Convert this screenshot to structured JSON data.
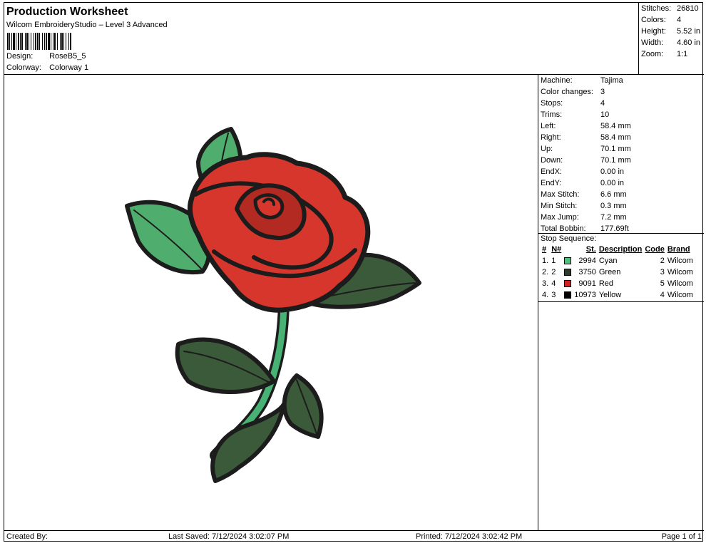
{
  "header": {
    "title": "Production Worksheet",
    "subtitle": "Wilcom EmbroideryStudio – Level 3 Advanced",
    "design_label": "Design:",
    "design_value": "RoseB5_5",
    "colorway_label": "Colorway:",
    "colorway_value": "Colorway 1"
  },
  "summary": [
    {
      "label": "Stitches:",
      "value": "26810"
    },
    {
      "label": "Colors:",
      "value": "4"
    },
    {
      "label": "Height:",
      "value": "5.52 in"
    },
    {
      "label": "Width:",
      "value": "4.60 in"
    },
    {
      "label": "Zoom:",
      "value": "1:1"
    }
  ],
  "details": [
    {
      "label": "Machine:",
      "value": "Tajima"
    },
    {
      "label": "Color changes:",
      "value": "3"
    },
    {
      "label": "Stops:",
      "value": "4"
    },
    {
      "label": "Trims:",
      "value": "10"
    },
    {
      "label": "Left:",
      "value": "58.4 mm"
    },
    {
      "label": "Right:",
      "value": "58.4 mm"
    },
    {
      "label": "Up:",
      "value": "70.1 mm"
    },
    {
      "label": "Down:",
      "value": "70.1 mm"
    },
    {
      "label": "EndX:",
      "value": "0.00 in"
    },
    {
      "label": "EndY:",
      "value": "0.00 in"
    },
    {
      "label": "Max Stitch:",
      "value": "6.6 mm"
    },
    {
      "label": "Min Stitch:",
      "value": "0.3 mm"
    },
    {
      "label": "Max Jump:",
      "value": "7.2 mm"
    },
    {
      "label": "Total Bobbin:",
      "value": "177.69ft"
    }
  ],
  "stop_sequence": {
    "title": "Stop Sequence:",
    "headers": {
      "stop": "#",
      "needle": "N#",
      "stitches": "St.",
      "description": "Description",
      "code": "Code",
      "brand": "Brand"
    },
    "rows": [
      {
        "stop": "1.",
        "needle": "1",
        "color": "#4fbf7e",
        "stitches": "2994",
        "description": "Cyan",
        "code": "2",
        "brand": "Wilcom"
      },
      {
        "stop": "2.",
        "needle": "2",
        "color": "#2e3a2e",
        "stitches": "3750",
        "description": "Green",
        "code": "3",
        "brand": "Wilcom"
      },
      {
        "stop": "3.",
        "needle": "4",
        "color": "#d42020",
        "stitches": "9091",
        "description": "Red",
        "code": "5",
        "brand": "Wilcom"
      },
      {
        "stop": "4.",
        "needle": "3",
        "color": "#000000",
        "stitches": "10973",
        "description": "Yellow",
        "code": "4",
        "brand": "Wilcom"
      }
    ]
  },
  "footer": {
    "created_by": "Created By:",
    "last_saved": "Last Saved: 7/12/2024 3:02:07 PM",
    "printed": "Printed: 7/12/2024 3:02:42 PM",
    "page": "Page 1 of 1"
  },
  "colors": {
    "petal": "#d7362c",
    "petal_dark": "#b22a22",
    "outline": "#1c1c1c",
    "leaf_light": "#4fae6d",
    "leaf_dark": "#3b5a3a",
    "stem": "#47b274"
  }
}
